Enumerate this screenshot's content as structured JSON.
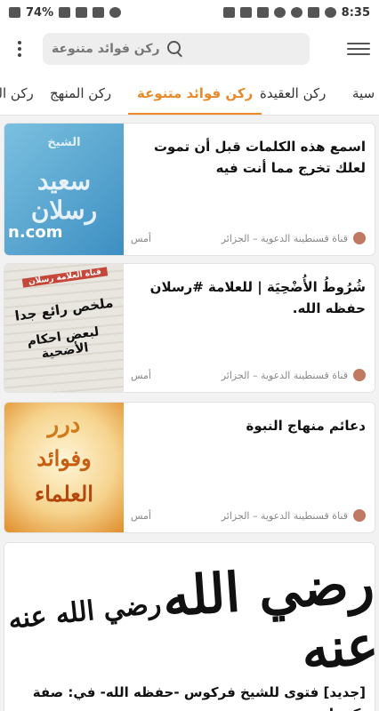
{
  "status": {
    "battery": "74%",
    "time": "8:35",
    "left_icons": [
      "battery-icon",
      "signal-4g-icon",
      "wifi-icon",
      "mute-icon",
      "alarm-icon"
    ],
    "right_icons": [
      "photo-icon",
      "translate-icon",
      "twitter-icon",
      "settings-icon",
      "messenger-icon",
      "notification-icon",
      "facebook-icon",
      "notification-icon"
    ]
  },
  "appbar": {
    "search_placeholder": "ركن فوائد متنوعة"
  },
  "tabs": [
    {
      "label": "ركن الـ",
      "active": false
    },
    {
      "label": "ركن المنهج",
      "active": false
    },
    {
      "label": "ركن فوائد متنوعة",
      "active": true
    },
    {
      "label": "ركن العقيدة",
      "active": false
    },
    {
      "label": "سية",
      "active": false
    }
  ],
  "cards": [
    {
      "title": "اسمع هذه الكلمات قبل أن تموت لعلك تخرج مما أنت فيه",
      "source": "قناة قسنطينة الدعوية – الجزائر",
      "time": "أمس",
      "thumb_text_1": "الشيخ",
      "thumb_text_2": "سعيد رسلان",
      "thumb_text_3": "n.com"
    },
    {
      "title": "شُرُوطُ الأُضْحِيَة | للعلامة #رسلان حفظه الله.",
      "source": "قناة قسنطينة الدعوية – الجزائر",
      "time": "أمس",
      "thumb_text_1": "ملخص رائع جدا",
      "thumb_text_2": "لبعض احكام الأضحية",
      "thumb_text_3": "قناة العلامة رسلان"
    },
    {
      "title": "دعائم منهاج النبوة",
      "source": "قناة قسنطينة الدعوية – الجزائر",
      "time": "أمس",
      "thumb_text_1": "درر",
      "thumb_text_2": "وفوائد",
      "thumb_text_3": "العلماء"
    },
    {
      "title": "[جديد] فتوى للشيخ فركوس -حفظه الله- في: صفة تكبيرات",
      "image_text_left": "رضي الله عنه",
      "image_text_right": "رضي الله عنه"
    }
  ],
  "colors": {
    "accent": "#e88a2a",
    "background": "#f2f2f2"
  }
}
